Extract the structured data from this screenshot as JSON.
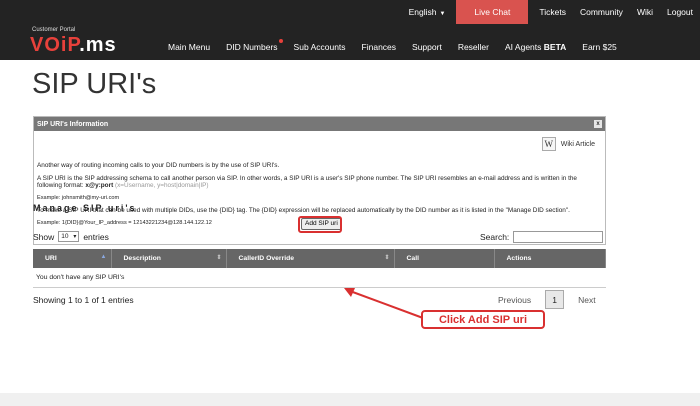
{
  "topbar": {
    "language": "English",
    "live_chat": "Live Chat",
    "links": [
      "Tickets",
      "Community",
      "Wiki",
      "Logout"
    ]
  },
  "logo": {
    "subtitle": "Customer Portal",
    "brand_a": "VOiP",
    "brand_b": ".ms"
  },
  "nav": {
    "main_menu": "Main Menu",
    "did_numbers": "DID Numbers",
    "sub_accounts": "Sub Accounts",
    "finances": "Finances",
    "support": "Support",
    "reseller": "Reseller",
    "ai_agents": "AI Agents",
    "ai_badge": "BETA",
    "earn": "Earn $25"
  },
  "page": {
    "title": "SIP URI's"
  },
  "info": {
    "header": "SIP URI's Information",
    "close": "x",
    "wiki_label": "Wiki Article",
    "p1": "Another way of routing incoming calls to your DID numbers is by the use of SIP URI's.",
    "p2a": "A SIP URI is the SIP addressing schema to call another person via SIP. In other words, a SIP URI is a user's SIP phone number. The SIP URI resembles an e-mail address and is written in the following format: ",
    "p2b": "x@y:port",
    "p2c": " (x=Username, y=host|domain|IP)",
    "example1": "Example: johnsmith@my-uri.com",
    "p3": "To make a SIP URI that can be used with multiple DIDs, use the {DID} tag. The {DID} expression will be replaced automatically by the DID number as it is listed in the \"Manage DID section\".",
    "example2": "Example: 1{DID}@Your_IP_address = 12143221234@128.144.122.12"
  },
  "manage": {
    "title": "Manage SIP uri's",
    "add_button": "Add SIP uri",
    "show_label": "Show",
    "entries_value": "10",
    "entries_label": "entries",
    "search_label": "Search:",
    "columns": [
      "URI",
      "Description",
      "CallerID Override",
      "Call",
      "Actions"
    ],
    "empty": "You don't have any SIP URI's",
    "showing": "Showing 1 to 1 of 1 entries",
    "prev": "Previous",
    "page": "1",
    "next": "Next"
  },
  "callout": "Click Add SIP uri",
  "colors": {
    "accent_red": "#d93030",
    "topbar": "#232323",
    "header_gray": "#666666"
  }
}
